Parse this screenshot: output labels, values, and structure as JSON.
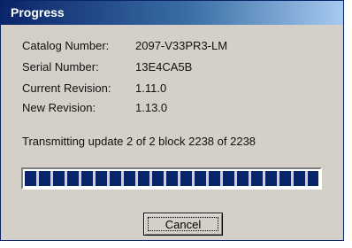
{
  "window": {
    "title": "Progress"
  },
  "info": {
    "catalog_label": "Catalog Number:",
    "catalog_value": "2097-V33PR3-LM",
    "serial_label": "Serial Number:",
    "serial_value": "13E4CA5B",
    "current_rev_label": "Current Revision:",
    "current_rev_value": "1.11.0",
    "new_rev_label": "New Revision:",
    "new_rev_value": "1.13.0"
  },
  "status": {
    "text": "Transmitting update 2 of 2  block 2238 of 2238"
  },
  "progress": {
    "percent": 100
  },
  "buttons": {
    "cancel_label": "Cancel"
  },
  "colors": {
    "titlebar_start": "#0a246a",
    "titlebar_end": "#a6caf0",
    "progress_block": "#0a246a",
    "dialog_face": "#d4d0c8"
  }
}
